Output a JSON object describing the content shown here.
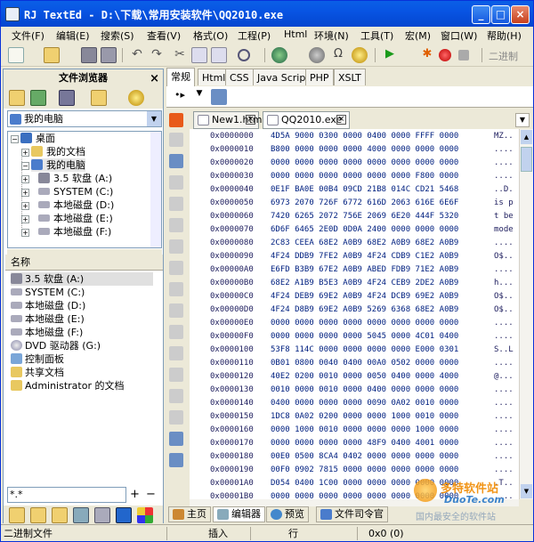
{
  "window": {
    "title": "RJ TextEd - D:\\下载\\常用安装软件\\QQ2010.exe",
    "min": "_",
    "max": "□",
    "close": "×"
  },
  "menu": [
    "文件(F)",
    "编辑(E)",
    "搜索(S)",
    "查看(V)",
    "格式(O)",
    "工程(P)",
    "Html",
    "环境(N)",
    "工具(T)",
    "宏(M)",
    "窗口(W)",
    "帮助(H)"
  ],
  "toolbar": {
    "right_label": "二进制"
  },
  "left": {
    "title": "文件浏览器",
    "close": "×",
    "drive": "我的电脑",
    "tree": [
      "桌面",
      "我的文档",
      "我的电脑",
      "3.5 软盘 (A:)",
      "SYSTEM (C:)",
      "本地磁盘 (D:)",
      "本地磁盘 (E:)",
      "本地磁盘 (F:)"
    ],
    "list_header": "名称",
    "files": [
      "3.5 软盘 (A:)",
      "SYSTEM (C:)",
      "本地磁盘 (D:)",
      "本地磁盘 (E:)",
      "本地磁盘 (F:)",
      "DVD 驱动器 (G:)",
      "控制面板",
      "共享文档",
      "Administrator 的文档"
    ],
    "filter": "*.*"
  },
  "tabs": [
    "常规",
    "Html",
    "CSS",
    "Java Script",
    "PHP",
    "XSLT"
  ],
  "doctabs": [
    {
      "name": "New1.html"
    },
    {
      "name": "QQ2010.exe"
    }
  ],
  "hex": [
    {
      "addr": "0x0000000",
      "data": "4D5A 9000 0300 0000 0400 0000 FFFF 0000",
      "text": "MZ.."
    },
    {
      "addr": "0x0000010",
      "data": "B800 0000 0000 0000 4000 0000 0000 0000",
      "text": "...."
    },
    {
      "addr": "0x0000020",
      "data": "0000 0000 0000 0000 0000 0000 0000 0000",
      "text": "...."
    },
    {
      "addr": "0x0000030",
      "data": "0000 0000 0000 0000 0000 0000 F800 0000",
      "text": "...."
    },
    {
      "addr": "0x0000040",
      "data": "0E1F BA0E 00B4 09CD 21B8 014C CD21 5468",
      "text": "..D."
    },
    {
      "addr": "0x0000050",
      "data": "6973 2070 726F 6772 616D 2063 616E 6E6F",
      "text": "is p"
    },
    {
      "addr": "0x0000060",
      "data": "7420 6265 2072 756E 2069 6E20 444F 5320",
      "text": "t be"
    },
    {
      "addr": "0x0000070",
      "data": "6D6F 6465 2E0D 0D0A 2400 0000 0000 0000",
      "text": "mode"
    },
    {
      "addr": "0x0000080",
      "data": "2C83 CEEA 68E2 A0B9 68E2 A0B9 68E2 A0B9",
      "text": "...."
    },
    {
      "addr": "0x0000090",
      "data": "4F24 DDB9 7FE2 A0B9 4F24 CDB9 C1E2 A0B9",
      "text": "O$.."
    },
    {
      "addr": "0x00000A0",
      "data": "E6FD B3B9 67E2 A0B9 ABED FDB9 71E2 A0B9",
      "text": "...."
    },
    {
      "addr": "0x00000B0",
      "data": "68E2 A1B9 B5E3 A0B9 4F24 CEB9 2DE2 A0B9",
      "text": "h..."
    },
    {
      "addr": "0x00000C0",
      "data": "4F24 DEB9 69E2 A0B9 4F24 DCB9 69E2 A0B9",
      "text": "O$.."
    },
    {
      "addr": "0x00000D0",
      "data": "4F24 D8B9 69E2 A0B9 5269 6368 68E2 A0B9",
      "text": "O$.."
    },
    {
      "addr": "0x00000E0",
      "data": "0000 0000 0000 0000 0000 0000 0000 0000",
      "text": "...."
    },
    {
      "addr": "0x00000F0",
      "data": "0000 0000 0000 0000 5045 0000 4C01 0400",
      "text": "...."
    },
    {
      "addr": "0x0000100",
      "data": "53F8 114C 0000 0000 0000 0000 E000 0301",
      "text": "S..L"
    },
    {
      "addr": "0x0000110",
      "data": "0B01 0800 0040 0400 00A0 0502 0000 0000",
      "text": "...."
    },
    {
      "addr": "0x0000120",
      "data": "40E2 0200 0010 0000 0050 0400 0000 4000",
      "text": "@..."
    },
    {
      "addr": "0x0000130",
      "data": "0010 0000 0010 0000 0400 0000 0000 0000",
      "text": "...."
    },
    {
      "addr": "0x0000140",
      "data": "0400 0000 0000 0000 0090 0A02 0010 0000",
      "text": "...."
    },
    {
      "addr": "0x0000150",
      "data": "1DC8 0A02 0200 0000 0000 1000 0010 0000",
      "text": "...."
    },
    {
      "addr": "0x0000160",
      "data": "0000 1000 0010 0000 0000 0000 1000 0000",
      "text": "...."
    },
    {
      "addr": "0x0000170",
      "data": "0000 0000 0000 0000 48F9 0400 4001 0000",
      "text": "...."
    },
    {
      "addr": "0x0000180",
      "data": "00E0 0500 8CA4 0402 0000 0000 0000 0000",
      "text": "...."
    },
    {
      "addr": "0x0000190",
      "data": "00F0 0902 7815 0000 0000 0000 0000 0000",
      "text": "...."
    },
    {
      "addr": "0x00001A0",
      "data": "D054 0400 1C00 0000 0000 0000 0000 0000",
      "text": ".T.."
    },
    {
      "addr": "0x00001B0",
      "data": "0000 0000 0000 0000 0000 0000 0000 0000",
      "text": "...."
    }
  ],
  "bottomtabs": [
    "主页",
    "编辑器",
    "预览",
    "文件司令官"
  ],
  "status": {
    "mode": "二进制文件",
    "insert": "插入",
    "line": "行",
    "pos": "0x0 (0)"
  },
  "watermark": {
    "line1": "多特软件站",
    "line2": "DuoTe.com",
    "line3": "国内最安全的软件站"
  }
}
